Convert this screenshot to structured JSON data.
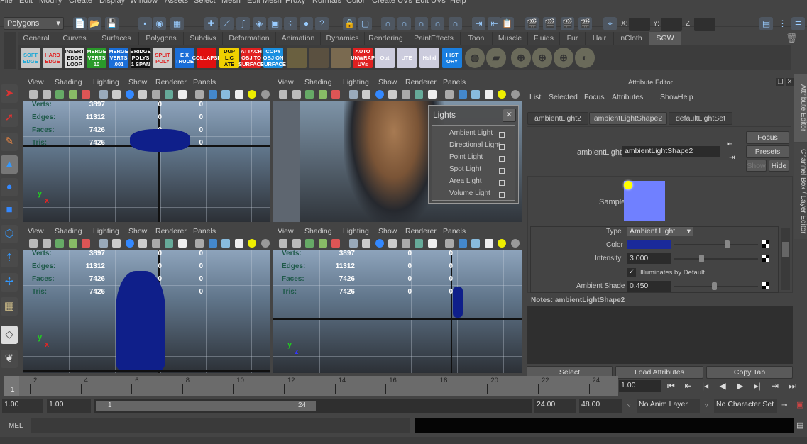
{
  "menubar": [
    "File",
    "Edit",
    "Modify",
    "Create",
    "Display",
    "Window",
    "Assets",
    "Select",
    "Mesh",
    "Edit Mesh",
    "Proxy",
    "Normals",
    "Color",
    "Create UVs",
    "Edit UVs",
    "Help"
  ],
  "status": {
    "mode": "Polygons",
    "x_label": "X:",
    "y_label": "Y:",
    "z_label": "Z:"
  },
  "shelf_tabs": [
    "General",
    "Curves",
    "Surfaces",
    "Polygons",
    "Subdivs",
    "Deformation",
    "Animation",
    "Dynamics",
    "Rendering",
    "PaintEffects",
    "Toon",
    "Muscle",
    "Fluids",
    "Fur",
    "Hair",
    "nCloth",
    "SGW"
  ],
  "active_shelf_tab": "SGW",
  "shelf_buttons": [
    {
      "label": "SOFT EDGE",
      "bg": "#c8c8c8",
      "fg": "#1aa7d6"
    },
    {
      "label": "HARD EDGE",
      "bg": "#c8c8c8",
      "fg": "#e02020"
    },
    {
      "label": "INSERT EDGE LOOP",
      "bg": "#ddd",
      "fg": "#111"
    },
    {
      "label": "MERGE VERTS 10",
      "bg": "#2a9a2a",
      "fg": "#fff"
    },
    {
      "label": "MERGE VERTS .001",
      "bg": "#1a6ed8",
      "fg": "#fff"
    },
    {
      "label": "BRIDGE POLYS 1 SPAN",
      "bg": "#111",
      "fg": "#fff"
    },
    {
      "label": "SPLIT POLY",
      "bg": "#ccc",
      "fg": "#e02020"
    },
    {
      "label": "E X TRUDE",
      "bg": "#1a6ed8",
      "fg": "#fff"
    },
    {
      "label": "COLLAPSE",
      "bg": "#e01010",
      "fg": "#fff"
    },
    {
      "label": "DUP LIC ATE",
      "bg": "#f0d000",
      "fg": "#111"
    },
    {
      "label": "ATTACH OBJ TO SURFACE",
      "bg": "#e02020",
      "fg": "#fff"
    },
    {
      "label": "COPY OBJ ON SURFACE",
      "bg": "#1a8fe0",
      "fg": "#fff"
    },
    {
      "label": "",
      "bg": "#6a6040",
      "fg": "#fff"
    },
    {
      "label": "",
      "bg": "#5a5040",
      "fg": "#fff"
    },
    {
      "label": "",
      "bg": "#7a6a50",
      "fg": "#fff"
    },
    {
      "label": "AUTO UNWRAP UVs",
      "bg": "#e02020",
      "fg": "#fff"
    },
    {
      "label": "Out",
      "bg": "#ccd",
      "fg": "#fff"
    },
    {
      "label": "UTE",
      "bg": "#ccd",
      "fg": "#fff"
    },
    {
      "label": "Hshd",
      "bg": "#ccd",
      "fg": "#fff"
    },
    {
      "label": "HIST ORY",
      "bg": "#1a7fe0",
      "fg": "#fff"
    }
  ],
  "viewport_menu": [
    "View",
    "Shading",
    "Lighting",
    "Show",
    "Renderer",
    "Panels"
  ],
  "hud": {
    "labels": [
      "Verts:",
      "Edges:",
      "Faces:",
      "Tris:"
    ],
    "values": [
      [
        "3897",
        "0",
        "0"
      ],
      [
        "11312",
        "0",
        "0"
      ],
      [
        "7426",
        "0",
        "0"
      ],
      [
        "7426",
        "0",
        "0"
      ]
    ]
  },
  "axis": {
    "y": "y",
    "x": "x",
    "z": "z"
  },
  "lights_popup": {
    "title": "Lights",
    "close": "✕",
    "items": [
      "Ambient Light",
      "Directional Light",
      "Point Light",
      "Spot Light",
      "Area Light",
      "Volume Light"
    ]
  },
  "attribute_editor": {
    "title": "Attribute Editor",
    "menu": [
      "List",
      "Selected",
      "Focus",
      "Attributes",
      "Show",
      "Help"
    ],
    "tabs": [
      "ambientLight2",
      "ambientLightShape2",
      "defaultLightSet"
    ],
    "active_tab": "ambientLightShape2",
    "node_label": "ambientLight:",
    "node_value": "ambientLightShape2",
    "focus": "Focus",
    "presets": "Presets",
    "show": "Show",
    "hide": "Hide",
    "sample_label": "Sample",
    "sample_color": "#7080ff",
    "type_label": "Type",
    "type_value": "Ambient Light",
    "color_label": "Color",
    "color_value": "#1a2a9a",
    "color_slider": 0.6,
    "intensity_label": "Intensity",
    "intensity_value": "3.000",
    "intensity_slider": 0.3,
    "illuminates_label": "Illuminates by Default",
    "illuminates_checked": true,
    "ambient_shade_label": "Ambient Shade",
    "ambient_shade_value": "0.450",
    "ambient_shade_slider": 0.45,
    "notes_label": "Notes:  ambientLightShape2",
    "buttons": [
      "Select",
      "Load Attributes",
      "Copy Tab"
    ]
  },
  "side_tabs": [
    "Attribute Editor",
    "Channel Box / Layer Editor"
  ],
  "timeline": {
    "ticks": [
      "2",
      "4",
      "6",
      "8",
      "10",
      "12",
      "14",
      "16",
      "18",
      "20",
      "22",
      "24"
    ],
    "start_marker": "1",
    "current_frame": "1.00"
  },
  "range": {
    "start": "1.00",
    "playback_start": "1.00",
    "slider_min": "1",
    "slider_max": "24",
    "playback_end": "24.00",
    "end": "48.00",
    "anim_layer": "No Anim Layer",
    "character_set": "No Character Set"
  },
  "mel": {
    "label": "MEL"
  }
}
